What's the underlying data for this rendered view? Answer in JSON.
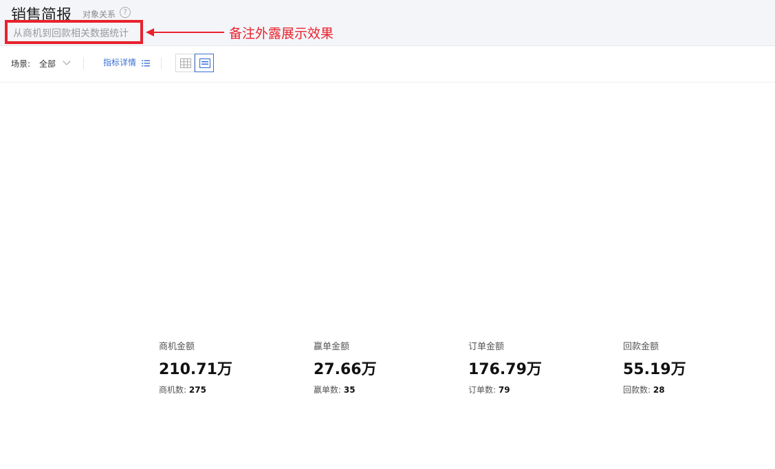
{
  "header": {
    "title": "销售简报",
    "relation_link": "对象关系",
    "help_icon": "?",
    "note": "从商机到回款相关数据统计",
    "annotation": "备注外露展示效果"
  },
  "toolbar": {
    "scene_label": "场景:",
    "scene_value": "全部",
    "detail_link": "指标详情",
    "view_modes": [
      "table-view-icon",
      "card-view-icon"
    ],
    "active_view": "card-view-icon"
  },
  "colors": {
    "annotation_red": "#e8212c",
    "link_blue": "#3b6fd6",
    "header_bg": "#f4f5f9"
  },
  "stats": [
    {
      "label": "商机金额",
      "value": "210.71万",
      "count_label": "商机数:",
      "count": "275"
    },
    {
      "label": "赢单金额",
      "value": "27.66万",
      "count_label": "赢单数:",
      "count": "35"
    },
    {
      "label": "订单金额",
      "value": "176.79万",
      "count_label": "订单数:",
      "count": "79"
    },
    {
      "label": "回款金额",
      "value": "55.19万",
      "count_label": "回款数:",
      "count": "28"
    }
  ]
}
